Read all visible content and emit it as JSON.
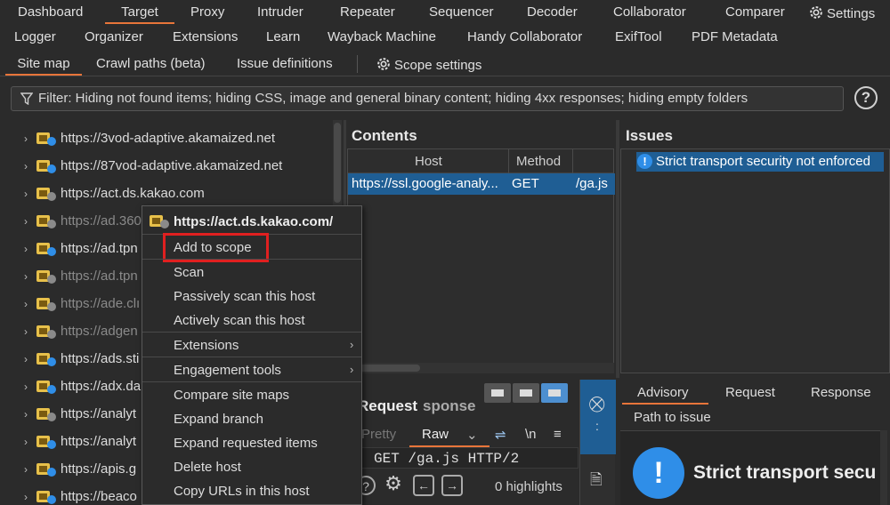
{
  "top_tabs_row1": [
    "Dashboard",
    "Target",
    "Proxy",
    "Intruder",
    "Repeater",
    "Sequencer",
    "Decoder",
    "Collaborator",
    "Comparer",
    "Settings"
  ],
  "top_tabs_row2": [
    "Logger",
    "Organizer",
    "Extensions",
    "Learn",
    "Wayback Machine",
    "Handy Collaborator",
    "ExifTool",
    "PDF Metadata"
  ],
  "sub_tabs": [
    "Site map",
    "Crawl paths (beta)",
    "Issue definitions",
    "Scope settings"
  ],
  "filter_text": "Filter: Hiding not found items;  hiding CSS, image and general binary content;  hiding 4xx responses;  hiding empty folders",
  "help_label": "?",
  "tree": [
    {
      "host": "https://3vod-adaptive.akamaized.net",
      "dim": false,
      "badge": "blue"
    },
    {
      "host": "https://87vod-adaptive.akamaized.net",
      "dim": false,
      "badge": "blue"
    },
    {
      "host": "https://act.ds.kakao.com",
      "dim": false,
      "badge": "gray"
    },
    {
      "host": "https://ad.360",
      "dim": true,
      "badge": "gray"
    },
    {
      "host": "https://ad.tpn",
      "dim": false,
      "badge": "blue"
    },
    {
      "host": "https://ad.tpn",
      "dim": true,
      "badge": "gray"
    },
    {
      "host": "https://ade.clı",
      "dim": true,
      "badge": "gray"
    },
    {
      "host": "https://adgen",
      "dim": true,
      "badge": "gray"
    },
    {
      "host": "https://ads.sti",
      "dim": false,
      "badge": "blue"
    },
    {
      "host": "https://adx.da",
      "dim": false,
      "badge": "blue"
    },
    {
      "host": "https://analyt",
      "dim": false,
      "badge": "gray"
    },
    {
      "host": "https://analyt",
      "dim": false,
      "badge": "blue"
    },
    {
      "host": "https://apis.g",
      "dim": false,
      "badge": "blue"
    },
    {
      "host": "https://beaco",
      "dim": false,
      "badge": "blue"
    }
  ],
  "contents": {
    "title": "Contents",
    "columns": [
      "Host",
      "Method"
    ],
    "row": {
      "host": "https://ssl.google-analy...",
      "method": "GET",
      "path": "/ga.js"
    }
  },
  "issues": {
    "title": "Issues",
    "item": "Strict transport security not enforced"
  },
  "request": {
    "title": "Request",
    "response_partial": "sponse",
    "tabs": [
      "Pretty",
      "Raw",
      "\\n"
    ],
    "code": "GET /ga.js HTTP/2",
    "highlights": "0 highlights"
  },
  "advisory": {
    "tabs": [
      "Advisory",
      "Request",
      "Response"
    ],
    "path_label": "Path to issue",
    "heading": "Strict transport secu"
  },
  "context_menu": {
    "title": "https://act.ds.kakao.com/",
    "items": [
      "Add to scope",
      "Scan",
      "Passively scan this host",
      "Actively scan this host",
      "Extensions",
      "Engagement tools",
      "Compare site maps",
      "Expand branch",
      "Expand requested items",
      "Delete host",
      "Copy URLs in this host"
    ]
  },
  "colors": {
    "accent": "#e8753a",
    "selection": "#1f5e94",
    "info": "#2f8ee8",
    "highlight_box": "#e02020"
  }
}
